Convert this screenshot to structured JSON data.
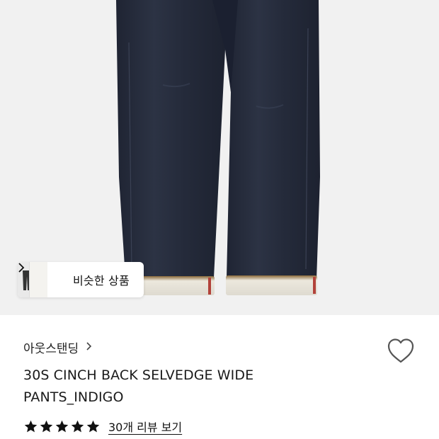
{
  "product": {
    "similar_label": "비슷한 상품",
    "brand": "아웃스탠딩",
    "title_line1": "30S CINCH BACK SELVEDGE WIDE",
    "title_line2": "PANTS_INDIGO",
    "review_link": "30개 리뷰 보기"
  },
  "rating": {
    "stars": 5,
    "max": 5
  },
  "icons": {
    "chevron": "chevron-right-icon",
    "wishlist": "heart-outline-icon",
    "star": "star-icon"
  },
  "colors": {
    "denim": "#272d3c",
    "selvedge": "#e7e3d8",
    "hero_bg": "#f1f1f1"
  }
}
